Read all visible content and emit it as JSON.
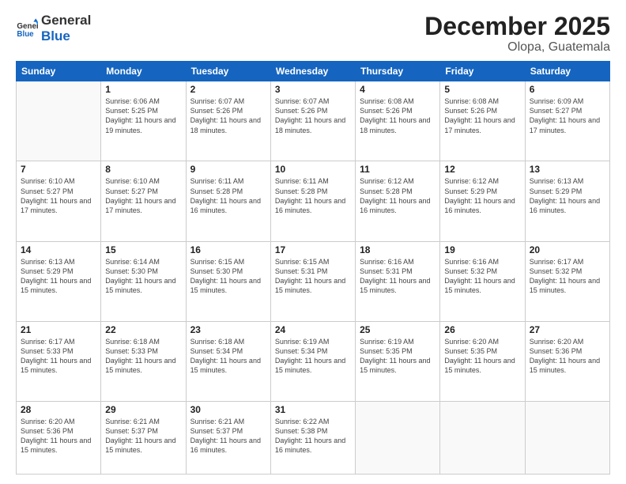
{
  "logo": {
    "line1": "General",
    "line2": "Blue"
  },
  "header": {
    "title": "December 2025",
    "subtitle": "Olopa, Guatemala"
  },
  "weekdays": [
    "Sunday",
    "Monday",
    "Tuesday",
    "Wednesday",
    "Thursday",
    "Friday",
    "Saturday"
  ],
  "weeks": [
    [
      {
        "day": "",
        "sunrise": "",
        "sunset": "",
        "daylight": ""
      },
      {
        "day": "1",
        "sunrise": "6:06 AM",
        "sunset": "5:25 PM",
        "daylight": "11 hours and 19 minutes."
      },
      {
        "day": "2",
        "sunrise": "6:07 AM",
        "sunset": "5:26 PM",
        "daylight": "11 hours and 18 minutes."
      },
      {
        "day": "3",
        "sunrise": "6:07 AM",
        "sunset": "5:26 PM",
        "daylight": "11 hours and 18 minutes."
      },
      {
        "day": "4",
        "sunrise": "6:08 AM",
        "sunset": "5:26 PM",
        "daylight": "11 hours and 18 minutes."
      },
      {
        "day": "5",
        "sunrise": "6:08 AM",
        "sunset": "5:26 PM",
        "daylight": "11 hours and 17 minutes."
      },
      {
        "day": "6",
        "sunrise": "6:09 AM",
        "sunset": "5:27 PM",
        "daylight": "11 hours and 17 minutes."
      }
    ],
    [
      {
        "day": "7",
        "sunrise": "6:10 AM",
        "sunset": "5:27 PM",
        "daylight": "11 hours and 17 minutes."
      },
      {
        "day": "8",
        "sunrise": "6:10 AM",
        "sunset": "5:27 PM",
        "daylight": "11 hours and 17 minutes."
      },
      {
        "day": "9",
        "sunrise": "6:11 AM",
        "sunset": "5:28 PM",
        "daylight": "11 hours and 16 minutes."
      },
      {
        "day": "10",
        "sunrise": "6:11 AM",
        "sunset": "5:28 PM",
        "daylight": "11 hours and 16 minutes."
      },
      {
        "day": "11",
        "sunrise": "6:12 AM",
        "sunset": "5:28 PM",
        "daylight": "11 hours and 16 minutes."
      },
      {
        "day": "12",
        "sunrise": "6:12 AM",
        "sunset": "5:29 PM",
        "daylight": "11 hours and 16 minutes."
      },
      {
        "day": "13",
        "sunrise": "6:13 AM",
        "sunset": "5:29 PM",
        "daylight": "11 hours and 16 minutes."
      }
    ],
    [
      {
        "day": "14",
        "sunrise": "6:13 AM",
        "sunset": "5:29 PM",
        "daylight": "11 hours and 15 minutes."
      },
      {
        "day": "15",
        "sunrise": "6:14 AM",
        "sunset": "5:30 PM",
        "daylight": "11 hours and 15 minutes."
      },
      {
        "day": "16",
        "sunrise": "6:15 AM",
        "sunset": "5:30 PM",
        "daylight": "11 hours and 15 minutes."
      },
      {
        "day": "17",
        "sunrise": "6:15 AM",
        "sunset": "5:31 PM",
        "daylight": "11 hours and 15 minutes."
      },
      {
        "day": "18",
        "sunrise": "6:16 AM",
        "sunset": "5:31 PM",
        "daylight": "11 hours and 15 minutes."
      },
      {
        "day": "19",
        "sunrise": "6:16 AM",
        "sunset": "5:32 PM",
        "daylight": "11 hours and 15 minutes."
      },
      {
        "day": "20",
        "sunrise": "6:17 AM",
        "sunset": "5:32 PM",
        "daylight": "11 hours and 15 minutes."
      }
    ],
    [
      {
        "day": "21",
        "sunrise": "6:17 AM",
        "sunset": "5:33 PM",
        "daylight": "11 hours and 15 minutes."
      },
      {
        "day": "22",
        "sunrise": "6:18 AM",
        "sunset": "5:33 PM",
        "daylight": "11 hours and 15 minutes."
      },
      {
        "day": "23",
        "sunrise": "6:18 AM",
        "sunset": "5:34 PM",
        "daylight": "11 hours and 15 minutes."
      },
      {
        "day": "24",
        "sunrise": "6:19 AM",
        "sunset": "5:34 PM",
        "daylight": "11 hours and 15 minutes."
      },
      {
        "day": "25",
        "sunrise": "6:19 AM",
        "sunset": "5:35 PM",
        "daylight": "11 hours and 15 minutes."
      },
      {
        "day": "26",
        "sunrise": "6:20 AM",
        "sunset": "5:35 PM",
        "daylight": "11 hours and 15 minutes."
      },
      {
        "day": "27",
        "sunrise": "6:20 AM",
        "sunset": "5:36 PM",
        "daylight": "11 hours and 15 minutes."
      }
    ],
    [
      {
        "day": "28",
        "sunrise": "6:20 AM",
        "sunset": "5:36 PM",
        "daylight": "11 hours and 15 minutes."
      },
      {
        "day": "29",
        "sunrise": "6:21 AM",
        "sunset": "5:37 PM",
        "daylight": "11 hours and 15 minutes."
      },
      {
        "day": "30",
        "sunrise": "6:21 AM",
        "sunset": "5:37 PM",
        "daylight": "11 hours and 16 minutes."
      },
      {
        "day": "31",
        "sunrise": "6:22 AM",
        "sunset": "5:38 PM",
        "daylight": "11 hours and 16 minutes."
      },
      {
        "day": "",
        "sunrise": "",
        "sunset": "",
        "daylight": ""
      },
      {
        "day": "",
        "sunrise": "",
        "sunset": "",
        "daylight": ""
      },
      {
        "day": "",
        "sunrise": "",
        "sunset": "",
        "daylight": ""
      }
    ]
  ],
  "labels": {
    "sunrise": "Sunrise:",
    "sunset": "Sunset:",
    "daylight": "Daylight:"
  }
}
